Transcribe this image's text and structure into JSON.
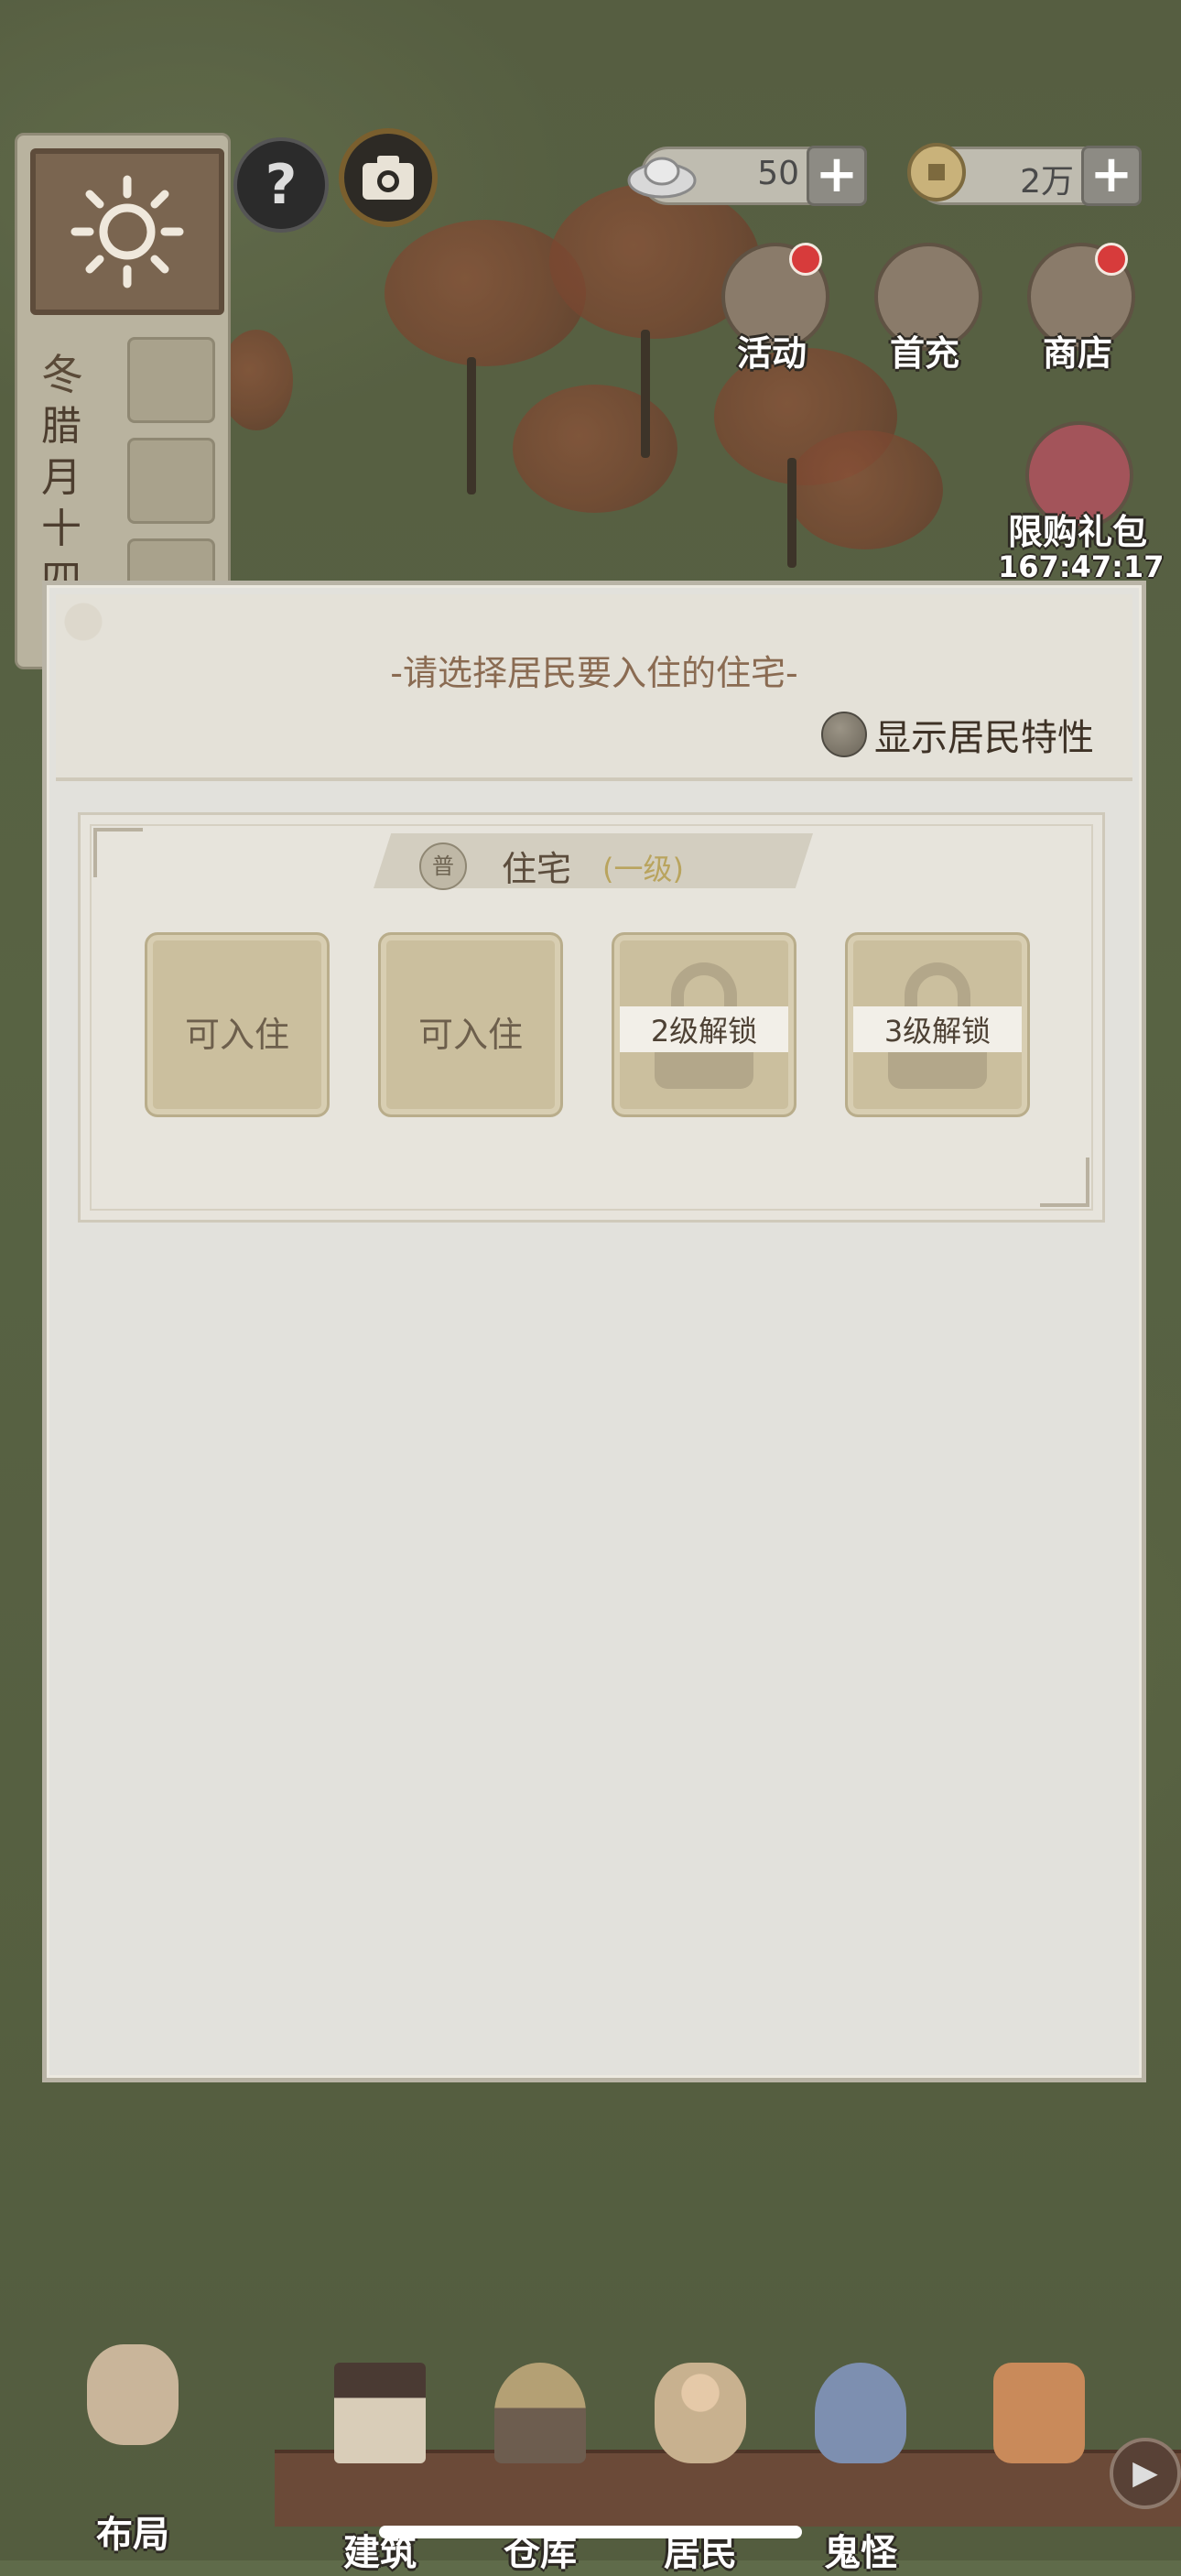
{
  "top_bar": {
    "help_icon": "question-icon",
    "camera_icon": "camera-icon",
    "silver": {
      "value": "50",
      "plus": "+"
    },
    "coins": {
      "value": "2万",
      "plus": "+"
    }
  },
  "calendar": {
    "weather_icon": "sun-icon",
    "season": "冬",
    "date": "腊月十四"
  },
  "right_menu": {
    "activity": "活动",
    "first_recharge": "首充",
    "shop": "商店",
    "limited_pack": "限购礼包",
    "timer": "167:47:17"
  },
  "dialog": {
    "title": "-请选择居民要入住的住宅-",
    "toggle_label": "显示居民特性",
    "section": {
      "badge": "普",
      "name": "住宅",
      "level": "(一级)",
      "slots": [
        {
          "label": "可入住",
          "locked": false
        },
        {
          "label": "可入住",
          "locked": false
        },
        {
          "label": "2级解锁",
          "locked": true
        },
        {
          "label": "3级解锁",
          "locked": true
        }
      ]
    }
  },
  "bottom_nav": {
    "layout": "布局",
    "build": "建筑",
    "warehouse": "仓库",
    "residents": "居民",
    "monsters": "鬼怪",
    "next": "▶"
  }
}
